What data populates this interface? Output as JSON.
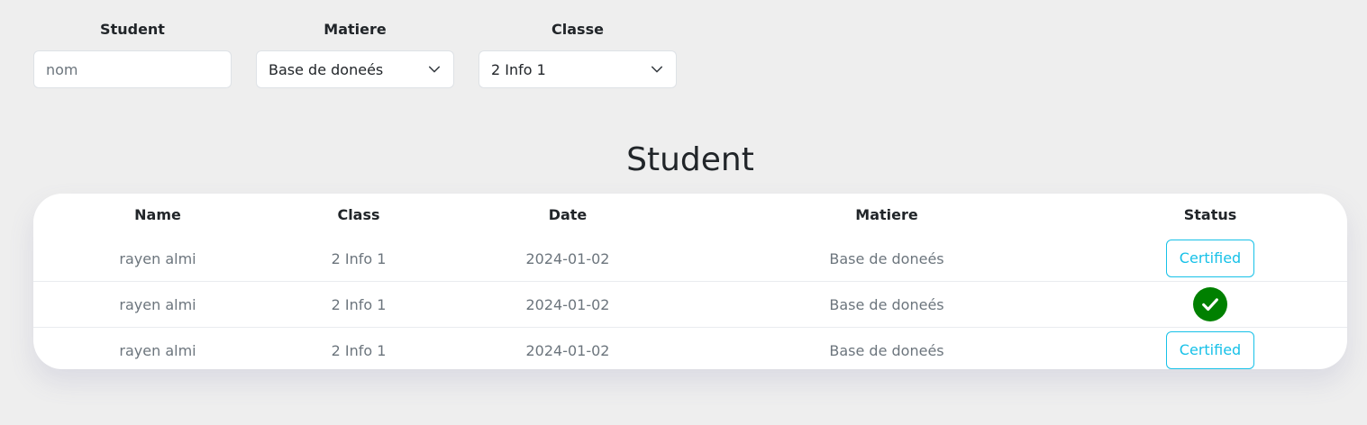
{
  "filters": {
    "student": {
      "label": "Student",
      "placeholder": "nom",
      "value": ""
    },
    "matiere": {
      "label": "Matiere",
      "selected": "Base de doneés"
    },
    "classe": {
      "label": "Classe",
      "selected": "2 Info 1"
    }
  },
  "section_title": "Student",
  "table": {
    "columns": [
      "Name",
      "Class",
      "Date",
      "Matiere",
      "Status"
    ],
    "rows": [
      {
        "name": "rayen almi",
        "class": "2 Info 1",
        "date": "2024-01-02",
        "matiere": "Base de doneés",
        "status_label": "Certified",
        "status_type": "button"
      },
      {
        "name": "rayen almi",
        "class": "2 Info 1",
        "date": "2024-01-02",
        "matiere": "Base de doneés",
        "status_label": "",
        "status_type": "check-icon"
      },
      {
        "name": "rayen almi",
        "class": "2 Info 1",
        "date": "2024-01-02",
        "matiere": "Base de doneés",
        "status_label": "Certified",
        "status_type": "button"
      }
    ]
  },
  "colors": {
    "background": "#eeeeee",
    "accent_info": "#17c1e8",
    "check_green": "#008000"
  }
}
